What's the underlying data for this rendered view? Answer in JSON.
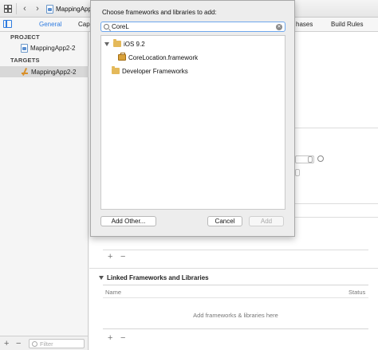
{
  "navbar": {
    "breadcrumb_file": "MappingApp"
  },
  "tabs": {
    "general": "General",
    "capabilities_partial": "Cap",
    "build_phases_partial": "hases",
    "build_rules": "Build Rules"
  },
  "sidebar": {
    "project_header": "PROJECT",
    "project_item": "MappingApp2-2",
    "targets_header": "TARGETS",
    "target_item": "MappingApp2-2"
  },
  "filter": {
    "placeholder": "Filter"
  },
  "linked": {
    "header": "Linked Frameworks and Libraries",
    "col_name": "Name",
    "col_status": "Status",
    "empty_text": "Add frameworks & libraries here"
  },
  "sheet": {
    "title": "Choose frameworks and libraries to add:",
    "search_value": "CoreL",
    "tree": [
      {
        "label": "iOS 9.2",
        "icon": "folder-icon",
        "level": 0,
        "expanded": true
      },
      {
        "label": "CoreLocation.framework",
        "icon": "toolbox-icon",
        "level": 1
      },
      {
        "label": "Developer Frameworks",
        "icon": "folder-icon",
        "level": 0
      }
    ],
    "add_other_label": "Add Other...",
    "cancel_label": "Cancel",
    "add_label": "Add"
  },
  "colors": {
    "accent": "#2f7ce0",
    "folder": "#e4b95a"
  }
}
